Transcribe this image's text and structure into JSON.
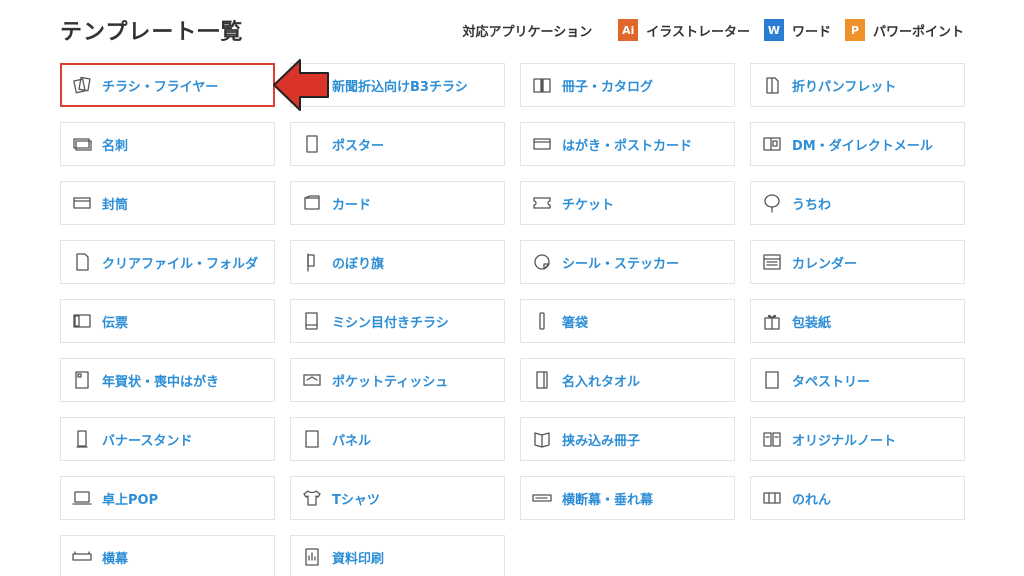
{
  "page": {
    "title": "テンプレート一覧"
  },
  "legend": {
    "label": "対応アプリケーション",
    "apps": [
      {
        "letter": "Ai",
        "name": "イラストレーター",
        "color": "#e0672a"
      },
      {
        "letter": "W",
        "name": "ワード",
        "color": "#2b7cd3"
      },
      {
        "letter": "P",
        "name": "パワーポイント",
        "color": "#f0902a"
      }
    ]
  },
  "accent_color": "#2d8ed6",
  "highlight_color": "#d9402f",
  "templates": [
    {
      "label": "チラシ・フライヤー",
      "icon": "flyers-icon",
      "highlighted": true
    },
    {
      "label": "新聞折込向けB3チラシ",
      "icon": "newspaper-insert-icon"
    },
    {
      "label": "冊子・カタログ",
      "icon": "book-icon"
    },
    {
      "label": "折りパンフレット",
      "icon": "folded-pamphlet-icon"
    },
    {
      "label": "名刺",
      "icon": "business-card-icon"
    },
    {
      "label": "ポスター",
      "icon": "poster-icon"
    },
    {
      "label": "はがき・ポストカード",
      "icon": "postcard-icon"
    },
    {
      "label": "DM・ダイレクトメール",
      "icon": "direct-mail-icon"
    },
    {
      "label": "封筒",
      "icon": "envelope-icon"
    },
    {
      "label": "カード",
      "icon": "card-icon"
    },
    {
      "label": "チケット",
      "icon": "ticket-icon"
    },
    {
      "label": "うちわ",
      "icon": "fan-icon"
    },
    {
      "label": "クリアファイル・フォルダ",
      "icon": "clear-file-icon"
    },
    {
      "label": "のぼり旗",
      "icon": "banner-flag-icon"
    },
    {
      "label": "シール・ステッカー",
      "icon": "sticker-icon"
    },
    {
      "label": "カレンダー",
      "icon": "calendar-icon"
    },
    {
      "label": "伝票",
      "icon": "slip-icon"
    },
    {
      "label": "ミシン目付きチラシ",
      "icon": "perforated-flyer-icon"
    },
    {
      "label": "箸袋",
      "icon": "chopstick-sleeve-icon"
    },
    {
      "label": "包装紙",
      "icon": "gift-wrap-icon"
    },
    {
      "label": "年賀状・喪中はがき",
      "icon": "greeting-card-icon"
    },
    {
      "label": "ポケットティッシュ",
      "icon": "pocket-tissue-icon"
    },
    {
      "label": "名入れタオル",
      "icon": "towel-icon"
    },
    {
      "label": "タペストリー",
      "icon": "tapestry-icon"
    },
    {
      "label": "バナースタンド",
      "icon": "banner-stand-icon"
    },
    {
      "label": "パネル",
      "icon": "panel-icon"
    },
    {
      "label": "挟み込み冊子",
      "icon": "insert-booklet-icon"
    },
    {
      "label": "オリジナルノート",
      "icon": "notebook-icon"
    },
    {
      "label": "卓上POP",
      "icon": "desktop-pop-icon"
    },
    {
      "label": "Tシャツ",
      "icon": "tshirt-icon"
    },
    {
      "label": "横断幕・垂れ幕",
      "icon": "horizontal-banner-icon"
    },
    {
      "label": "のれん",
      "icon": "noren-icon"
    },
    {
      "label": "横幕",
      "icon": "side-banner-icon"
    },
    {
      "label": "資料印刷",
      "icon": "document-print-icon"
    }
  ]
}
